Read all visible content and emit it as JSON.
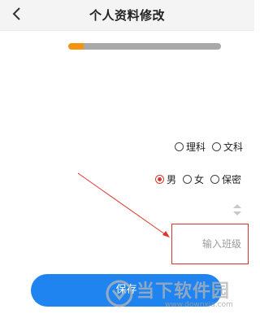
{
  "header": {
    "title": "个人资料修改",
    "back_icon": "chevron-left-icon"
  },
  "progress": {
    "fraction": 0.1
  },
  "subject_options": {
    "items": [
      {
        "label": "理科",
        "checked": false
      },
      {
        "label": "文科",
        "checked": false
      }
    ]
  },
  "gender_options": {
    "items": [
      {
        "label": "男",
        "checked": true
      },
      {
        "label": "女",
        "checked": false
      },
      {
        "label": "保密",
        "checked": false
      }
    ]
  },
  "class_input": {
    "placeholder": "输入班级",
    "value": ""
  },
  "save_button": {
    "label": "保存"
  },
  "watermark": {
    "text": "当下软件园",
    "url": "www.downxia.com"
  },
  "colors": {
    "accent": "#1f84f0",
    "progress": "#f39512",
    "radio_checked": "#d33a2f",
    "annotation": "#e0332a"
  }
}
